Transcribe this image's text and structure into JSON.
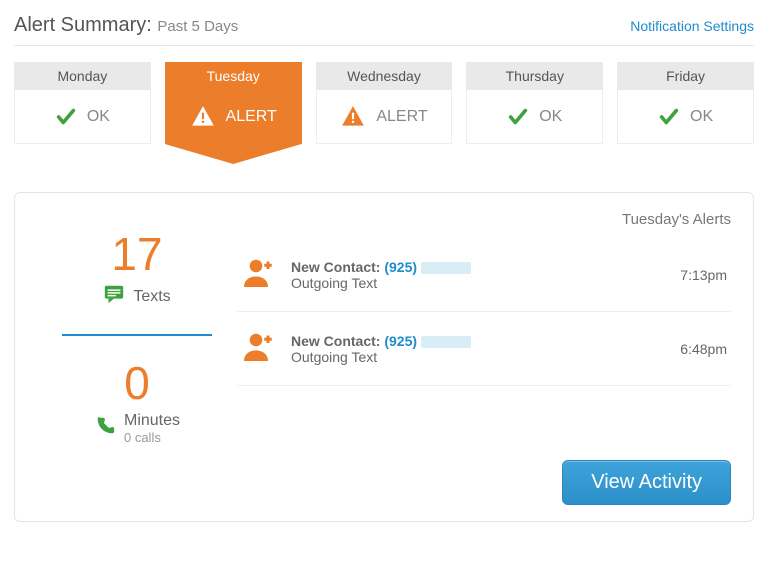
{
  "header": {
    "title": "Alert Summary:",
    "subtitle": "Past 5 Days",
    "settings_link": "Notification Settings"
  },
  "days": [
    {
      "name": "Monday",
      "status": "OK",
      "icon": "check",
      "selected": false
    },
    {
      "name": "Tuesday",
      "status": "ALERT",
      "icon": "alert",
      "selected": true
    },
    {
      "name": "Wednesday",
      "status": "ALERT",
      "icon": "alert",
      "selected": false
    },
    {
      "name": "Thursday",
      "status": "OK",
      "icon": "check",
      "selected": false
    },
    {
      "name": "Friday",
      "status": "OK",
      "icon": "check",
      "selected": false
    }
  ],
  "stats": {
    "texts_count": "17",
    "texts_label": "Texts",
    "minutes_count": "0",
    "minutes_label": "Minutes",
    "calls_sub": "0 calls"
  },
  "alerts_panel": {
    "title": "Tuesday's Alerts",
    "view_button": "View Activity"
  },
  "alerts": [
    {
      "label": "New Contact:",
      "number": "(925)",
      "sub": "Outgoing Text",
      "time": "7:13pm"
    },
    {
      "label": "New Contact:",
      "number": "(925)",
      "sub": "Outgoing Text",
      "time": "6:48pm"
    }
  ],
  "colors": {
    "accent_orange": "#ec7d2a",
    "accent_blue": "#1f8ccc",
    "ok_green": "#3fa13f"
  }
}
